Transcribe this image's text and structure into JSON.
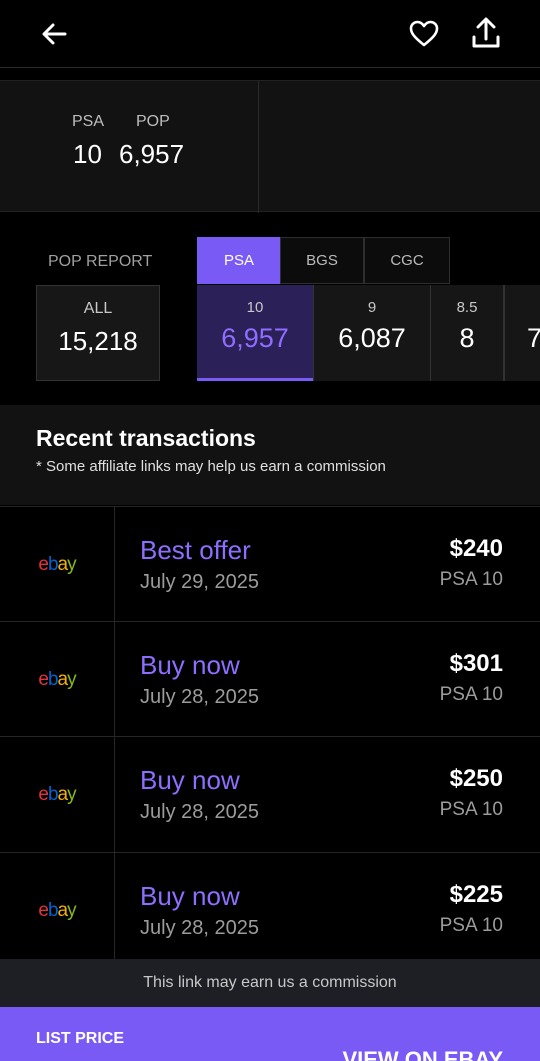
{
  "header": {
    "back_icon": "arrow-left-icon",
    "favorite_icon": "heart-icon",
    "share_icon": "share-icon"
  },
  "pop_summary": {
    "psa_label": "PSA",
    "psa_value": "10",
    "pop_label": "POP",
    "pop_value": "6,957"
  },
  "pop_report": {
    "label": "POP REPORT",
    "tabs": [
      {
        "label": "PSA",
        "active": true
      },
      {
        "label": "BGS",
        "active": false
      },
      {
        "label": "CGC",
        "active": false
      }
    ],
    "all": {
      "label": "ALL",
      "value": "15,218"
    },
    "grades": [
      {
        "label": "10",
        "value": "6,957",
        "selected": true
      },
      {
        "label": "9",
        "value": "6,087",
        "selected": false
      },
      {
        "label": "8.5",
        "value": "8",
        "selected": false
      },
      {
        "label": "",
        "value": "7",
        "selected": false
      }
    ]
  },
  "recent": {
    "title": "Recent transactions",
    "subtitle": "* Some affiliate links may help us earn a commission"
  },
  "transactions": [
    {
      "logo": "ebay",
      "type": "Best offer",
      "date": "July 29, 2025",
      "price": "$240",
      "grade": "PSA 10"
    },
    {
      "logo": "ebay",
      "type": "Buy now",
      "date": "July 28, 2025",
      "price": "$301",
      "grade": "PSA 10"
    },
    {
      "logo": "ebay",
      "type": "Buy now",
      "date": "July 28, 2025",
      "price": "$250",
      "grade": "PSA 10"
    },
    {
      "logo": "ebay",
      "type": "Buy now",
      "date": "July 28, 2025",
      "price": "$225",
      "grade": "PSA 10"
    }
  ],
  "footer": {
    "commission_note": "This link may earn us a commission",
    "list_price_label": "LIST PRICE",
    "cta_label": "VIEW ON EBAY"
  },
  "colors": {
    "accent": "#7a5af5",
    "accent_text": "#8e6dff",
    "ebay_e": "#e53238",
    "ebay_b": "#0064d2",
    "ebay_a": "#f5af02",
    "ebay_y": "#86b817"
  }
}
